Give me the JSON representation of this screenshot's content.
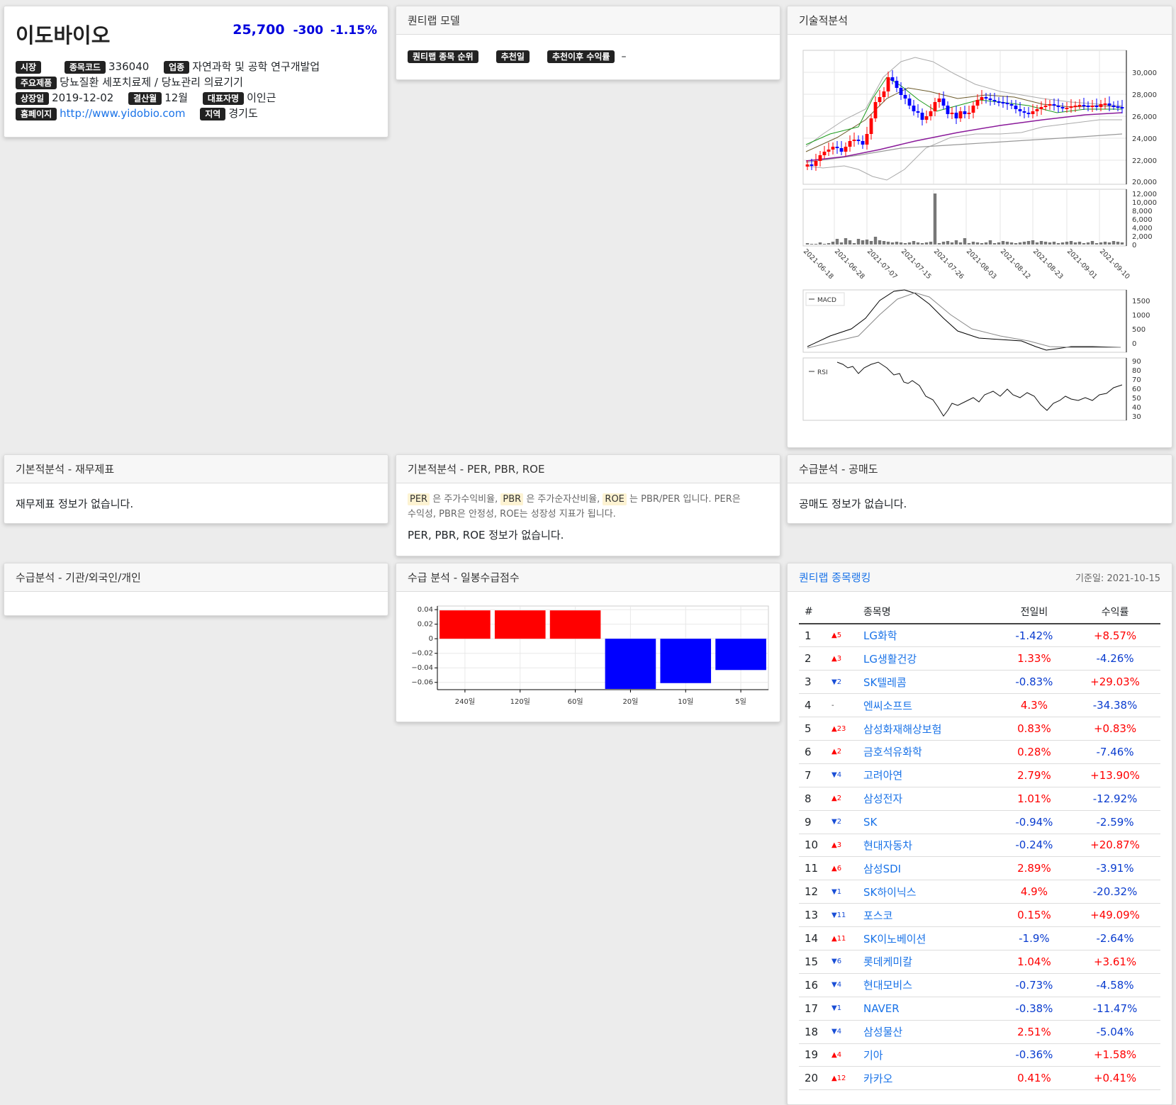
{
  "stock": {
    "name": "이도바이오",
    "price": "25,700",
    "change": "-300",
    "change_pct": "-1.15%",
    "market_label": "시장",
    "code_label": "종목코드",
    "code": "336040",
    "industry_label": "업종",
    "industry": "자연과학 및 공학 연구개발업",
    "product_label": "주요제품",
    "product": "당뇨질환 세포치료제 / 당뇨관리 의료기기",
    "listing_label": "상장일",
    "listing_date": "2019-12-02",
    "settle_label": "결산월",
    "settle_month": "12월",
    "ceo_label": "대표자명",
    "ceo": "이인근",
    "homepage_label": "홈페이지",
    "homepage": "http://www.yidobio.com",
    "region_label": "지역",
    "region": "경기도"
  },
  "quant_model": {
    "title": "퀀티랩 모델",
    "rank_label": "퀀티랩 종목 순위",
    "rec_date_label": "추천일",
    "return_label": "추천이후 수익률",
    "return_value": "–"
  },
  "technical": {
    "title": "기술적분석",
    "price_ticks": [
      "30,000",
      "28,000",
      "26,000",
      "24,000",
      "22,000",
      "20,000"
    ],
    "volume_ticks": [
      "12,000",
      "10,000",
      "8,000",
      "6,000",
      "4,000",
      "2,000",
      "0"
    ],
    "dates": [
      "2021-06-18",
      "2021-06-28",
      "2021-07-07",
      "2021-07-15",
      "2021-07-26",
      "2021-08-03",
      "2021-08-12",
      "2021-08-23",
      "2021-09-01",
      "2021-09-10"
    ],
    "macd_label": "MACD",
    "macd_ticks": [
      "1500",
      "1000",
      "500",
      "0"
    ],
    "rsi_label": "RSI",
    "rsi_ticks": [
      "90",
      "80",
      "70",
      "60",
      "50",
      "40",
      "30"
    ]
  },
  "fundamental_fin": {
    "title": "기본적분석 - 재무제표",
    "empty": "재무제표 정보가 없습니다."
  },
  "fundamental_per": {
    "title": "기본적분석 - PER, PBR, ROE",
    "per": "PER",
    "per_desc": "은 주가수익비율,",
    "pbr": "PBR",
    "pbr_desc": "은 주가순자산비율,",
    "roe": "ROE",
    "roe_desc": "는 PBR/PER 입니다. PER은",
    "desc_line2": "수익성, PBR은 안정성, ROE는 성장성 지표가 됩니다.",
    "empty": "PER, PBR, ROE 정보가 없습니다."
  },
  "short_sell": {
    "title": "수급분석 - 공매도",
    "empty": "공매도 정보가 없습니다."
  },
  "supply_inst": {
    "title": "수급분석 - 기관/외국인/개인"
  },
  "supply_score": {
    "title": "수급 분석 - 일봉수급점수",
    "ticks": [
      "0.04",
      "0.02",
      "0",
      "−0.02",
      "−0.04",
      "−0.06"
    ]
  },
  "chart_data": {
    "type": "bar",
    "categories": [
      "240일",
      "120일",
      "60일",
      "20일",
      "10일",
      "5일"
    ],
    "values": [
      0.039,
      0.039,
      0.039,
      -0.069,
      -0.061,
      -0.043
    ],
    "ylim": [
      -0.07,
      0.045
    ],
    "colors": {
      "positive": "#ff0000",
      "negative": "#0000ff"
    }
  },
  "ranking": {
    "title": "퀀티랩 종목랭킹",
    "base_date": "기준일: 2021-10-15",
    "headers": {
      "num": "#",
      "name": "종목명",
      "daily": "전일비",
      "return": "수익률"
    },
    "rows": [
      {
        "num": "1",
        "dir": "up",
        "chg": "▲5",
        "name": "LG화학",
        "daily": "-1.42%",
        "ret": "+8.57%"
      },
      {
        "num": "2",
        "dir": "up",
        "chg": "▲3",
        "name": "LG생활건강",
        "daily": "1.33%",
        "ret": "-4.26%"
      },
      {
        "num": "3",
        "dir": "down",
        "chg": "▼2",
        "name": "SK텔레콤",
        "daily": "-0.83%",
        "ret": "+29.03%"
      },
      {
        "num": "4",
        "dir": "none",
        "chg": "-",
        "name": "엔씨소프트",
        "daily": "4.3%",
        "ret": "-34.38%"
      },
      {
        "num": "5",
        "dir": "up",
        "chg": "▲23",
        "name": "삼성화재해상보험",
        "daily": "0.83%",
        "ret": "+0.83%"
      },
      {
        "num": "6",
        "dir": "up",
        "chg": "▲2",
        "name": "금호석유화학",
        "daily": "0.28%",
        "ret": "-7.46%"
      },
      {
        "num": "7",
        "dir": "down",
        "chg": "▼4",
        "name": "고려아연",
        "daily": "2.79%",
        "ret": "+13.90%"
      },
      {
        "num": "8",
        "dir": "up",
        "chg": "▲2",
        "name": "삼성전자",
        "daily": "1.01%",
        "ret": "-12.92%"
      },
      {
        "num": "9",
        "dir": "down",
        "chg": "▼2",
        "name": "SK",
        "daily": "-0.94%",
        "ret": "-2.59%"
      },
      {
        "num": "10",
        "dir": "up",
        "chg": "▲3",
        "name": "현대자동차",
        "daily": "-0.24%",
        "ret": "+20.87%"
      },
      {
        "num": "11",
        "dir": "up",
        "chg": "▲6",
        "name": "삼성SDI",
        "daily": "2.89%",
        "ret": "-3.91%"
      },
      {
        "num": "12",
        "dir": "down",
        "chg": "▼1",
        "name": "SK하이닉스",
        "daily": "4.9%",
        "ret": "-20.32%"
      },
      {
        "num": "13",
        "dir": "down",
        "chg": "▼11",
        "name": "포스코",
        "daily": "0.15%",
        "ret": "+49.09%"
      },
      {
        "num": "14",
        "dir": "up",
        "chg": "▲11",
        "name": "SK이노베이션",
        "daily": "-1.9%",
        "ret": "-2.64%"
      },
      {
        "num": "15",
        "dir": "down",
        "chg": "▼6",
        "name": "롯데케미칼",
        "daily": "1.04%",
        "ret": "+3.61%"
      },
      {
        "num": "16",
        "dir": "down",
        "chg": "▼4",
        "name": "현대모비스",
        "daily": "-0.73%",
        "ret": "-4.58%"
      },
      {
        "num": "17",
        "dir": "down",
        "chg": "▼1",
        "name": "NAVER",
        "daily": "-0.38%",
        "ret": "-11.47%"
      },
      {
        "num": "18",
        "dir": "down",
        "chg": "▼4",
        "name": "삼성물산",
        "daily": "2.51%",
        "ret": "-5.04%"
      },
      {
        "num": "19",
        "dir": "up",
        "chg": "▲4",
        "name": "기아",
        "daily": "-0.36%",
        "ret": "+1.58%"
      },
      {
        "num": "20",
        "dir": "up",
        "chg": "▲12",
        "name": "카카오",
        "daily": "0.41%",
        "ret": "+0.41%"
      }
    ]
  }
}
